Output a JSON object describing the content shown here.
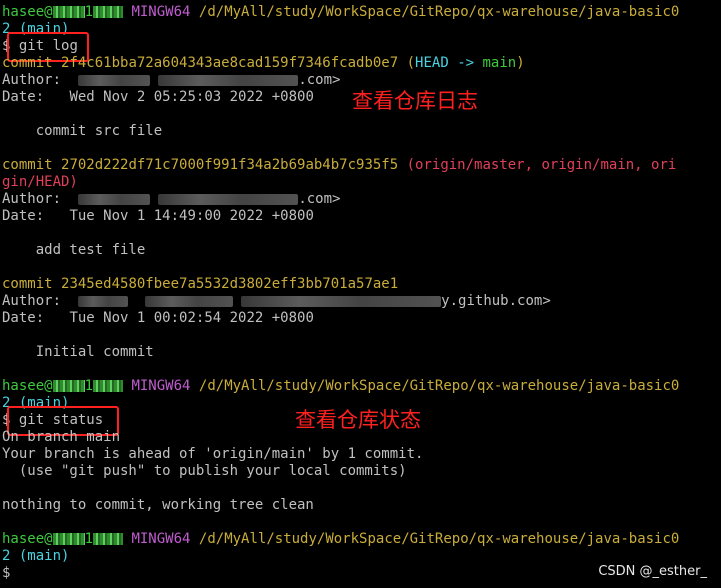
{
  "prompt": {
    "user": "hasee@",
    "num": "1",
    "shell": "MINGW64",
    "path": "/d/MyAll/study/WorkSpace/GitRepo/qx-warehouse/java-basic0",
    "branch_wrap": "2 (main)",
    "symbol": "$"
  },
  "log_cmd": {
    "text": "git log",
    "annotation": "查看仓库日志"
  },
  "commits": [
    {
      "word": "commit",
      "hash": "2f4c61bba72a604343ae8cad159f7346fcadb0e7",
      "refs_open": "(",
      "head": "HEAD",
      "arrow": " -> ",
      "main": "main",
      "refs_close": ")",
      "author_label": "Author:",
      "author_tail": ".com>",
      "date_label": "Date:",
      "date": "Wed Nov 2 05:25:03 2022 +0800",
      "message": "commit src file"
    },
    {
      "word": "commit",
      "hash": "2702d222df71c7000f991f34a2b69ab4b7c935f5",
      "refs_line1": "(origin/master, origin/main, ori",
      "refs_line2": "gin/HEAD)",
      "author_label": "Author:",
      "author_tail": ".com>",
      "date_label": "Date:",
      "date": "Tue Nov 1 14:49:00 2022 +0800",
      "message": "add test file"
    },
    {
      "word": "commit",
      "hash": "2345ed4580fbee7a5532d3802eff3bb701a57ae1",
      "author_label": "Author:",
      "author_tail": "y.github.com>",
      "date_label": "Date:",
      "date": "Tue Nov 1 00:02:54 2022 +0800",
      "message": "Initial commit"
    }
  ],
  "status_cmd": {
    "text": "git status",
    "annotation": "查看仓库状态"
  },
  "status_output": [
    "On branch main",
    "Your branch is ahead of 'origin/main' by 1 commit.",
    "  (use \"git push\" to publish your local commits)",
    "nothing to commit, working tree clean"
  ],
  "watermark": "CSDN @_esther_",
  "colors": {
    "prompt_user": "#3ec93e",
    "shell": "#c05cd0",
    "path": "#c9ad3a",
    "commit_hash": "#c9ad3a",
    "head_ref": "#48d3df",
    "remote_ref": "#e0405a",
    "annotation": "#ff2020"
  }
}
